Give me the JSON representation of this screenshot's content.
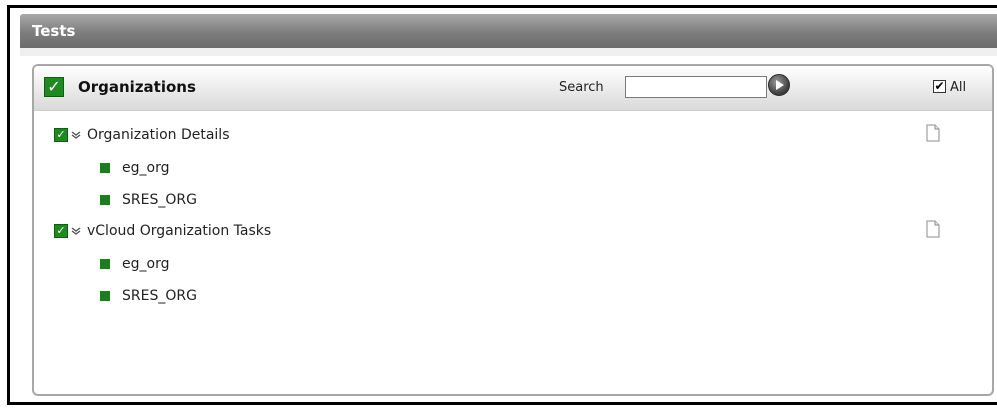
{
  "window": {
    "title": "Tests"
  },
  "panel": {
    "title": "Organizations",
    "search_label": "Search",
    "search_value": "",
    "all_label": "All",
    "all_checked": true
  },
  "tests": [
    {
      "label": "Organization Details",
      "checked": true,
      "items": [
        {
          "label": "eg_org"
        },
        {
          "label": "SRES_ORG"
        }
      ]
    },
    {
      "label": "vCloud Organization Tasks",
      "checked": true,
      "items": [
        {
          "label": "eg_org"
        },
        {
          "label": "SRES_ORG"
        }
      ]
    }
  ],
  "colors": {
    "check_green": "#1f8a1f",
    "title_bar_gray": "#7d7d7d"
  }
}
